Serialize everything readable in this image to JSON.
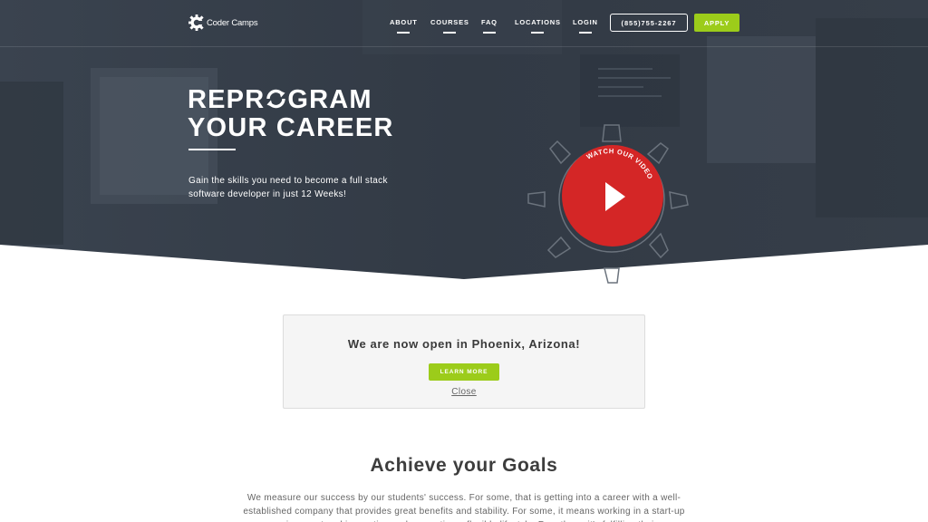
{
  "brand": {
    "name": "Coder Camps"
  },
  "nav": {
    "items": [
      {
        "label": "ABOUT"
      },
      {
        "label": "COURSES"
      },
      {
        "label": "FAQ"
      },
      {
        "label": "LOCATIONS"
      },
      {
        "label": "LOGIN"
      }
    ],
    "phone": "(855)755-2267",
    "apply": "APPLY"
  },
  "hero": {
    "headline_line1_pre": "REPR",
    "headline_line1_post": "GRAM",
    "headline_line2": "YOUR CAREER",
    "subtext": "Gain the skills you need to become a full stack software developer in just 12 Weeks!",
    "video_label": "WATCH OUR VIDEO"
  },
  "notice": {
    "title": "We are now open in Phoenix, Arizona!",
    "button": "LEARN MORE",
    "close": "Close"
  },
  "goals": {
    "title": "Achieve your Goals",
    "text": "We measure our success by our students' success. For some, that is getting into a career with a well-established company that provides great benefits and stability. For some, it means working in a start-up environment and innovating and supporting a flexible lifestyle. For others, it's fulfilling their"
  },
  "colors": {
    "hero_bg": "#333b46",
    "accent_green": "#9ccc1a",
    "play_red": "#d42626",
    "notice_bg": "#f5f5f5"
  }
}
